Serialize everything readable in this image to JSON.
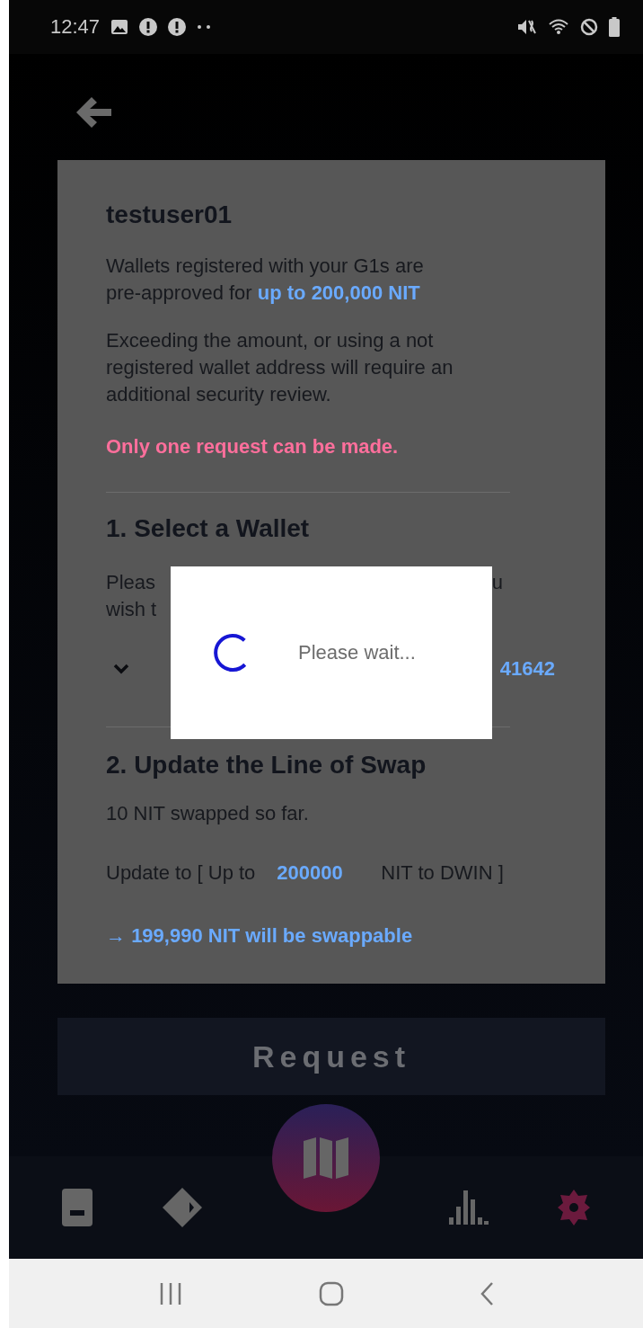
{
  "status_bar": {
    "time": "12:47"
  },
  "card": {
    "username": "testuser01",
    "intro": "Wallets registered with your G1s are pre-approved for **up to 200,000 NIT**",
    "notice": "Exceeding the amount, or using a not registered wallet address will require an additional security review.",
    "warning": "Only one request can be made.",
    "section1": {
      "title": "1. Select a Wallet",
      "prompt_start_1": "Pleas",
      "prompt_end_1": "u",
      "prompt_start_2": "wish t",
      "wallet_end": "41642"
    },
    "section2": {
      "title": "2. Update the Line of Swap",
      "swapped": "10 NIT swapped so far.",
      "update_prefix": "Update to [ Up to",
      "amount": "200000",
      "update_suffix": "NIT to DWIN ]",
      "result": "→ **199,990 NIT will be swappable**"
    }
  },
  "request_button": "Request",
  "dialog": {
    "message": "Please wait..."
  },
  "bottom_nav": [
    {
      "kind": "card",
      "selected": false
    },
    {
      "kind": "tag",
      "selected": false
    },
    {
      "kind": "map",
      "selected": false
    },
    {
      "kind": "chart",
      "selected": false
    },
    {
      "kind": "gear",
      "selected": true
    }
  ]
}
